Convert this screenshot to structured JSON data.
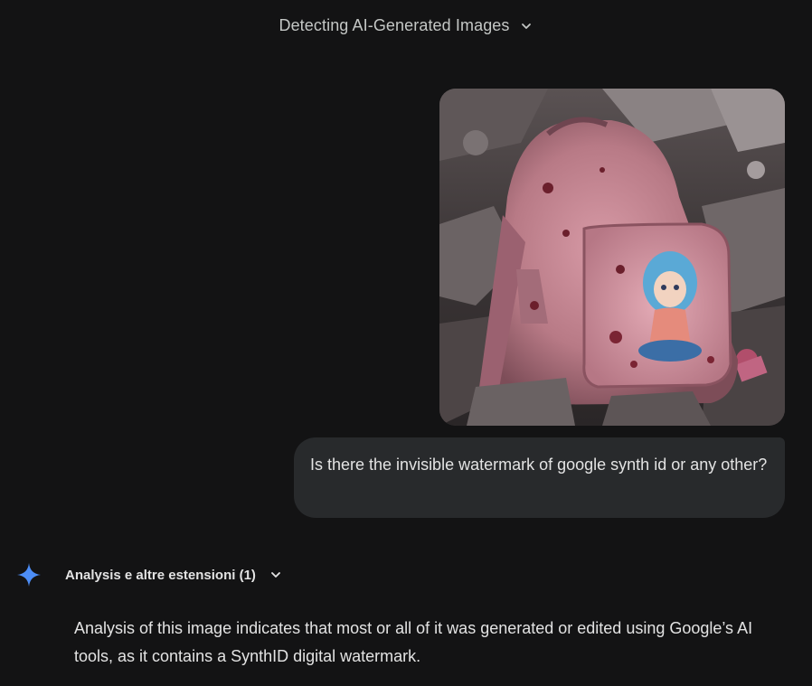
{
  "header": {
    "title": "Detecting AI-Generated Images",
    "title_icon": "chevron-down-icon"
  },
  "user_message": {
    "image_icon": "uploaded-photo",
    "text": "Is there the invisible watermark of google synth id or any other?"
  },
  "assistant": {
    "avatar_icon": "gemini-sparkle-icon",
    "avatar_color": "#4c8df6",
    "extensions_label": "Analysis e altre estensioni (1)",
    "extensions_icon": "chevron-down-icon",
    "response_text": "Analysis of this image indicates that most or all of it was generated or edited using Google’s AI tools, as it contains a SynthID digital watermark."
  },
  "colors": {
    "background": "#131314",
    "bubble": "#282a2c",
    "text": "#e3e3e3"
  }
}
